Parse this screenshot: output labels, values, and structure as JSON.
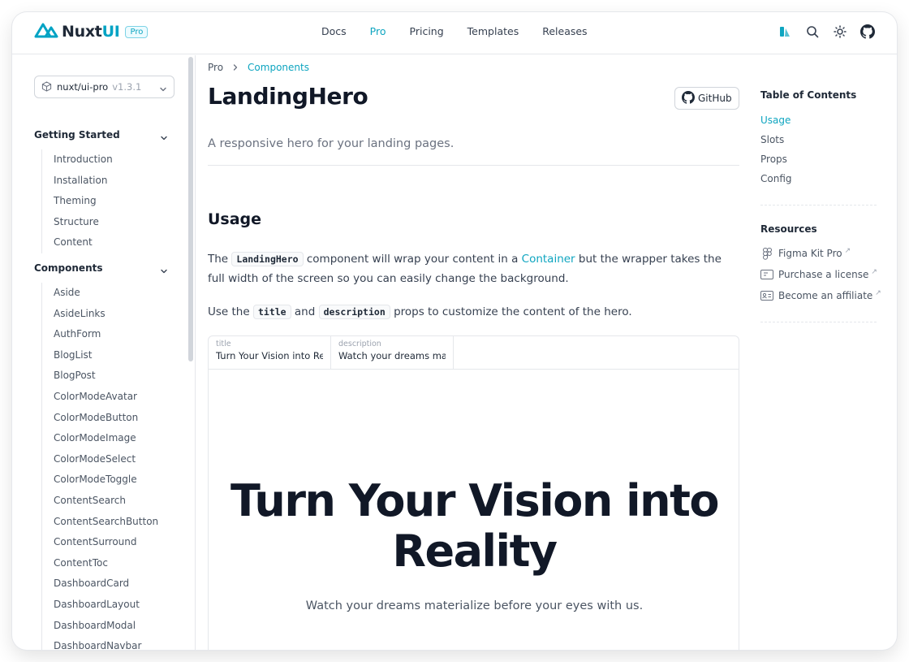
{
  "header": {
    "logo_text": "Nuxt",
    "logo_ui": "UI",
    "pro_badge": "Pro",
    "nav": [
      {
        "label": "Docs",
        "active": false
      },
      {
        "label": "Pro",
        "active": true
      },
      {
        "label": "Pricing",
        "active": false
      },
      {
        "label": "Templates",
        "active": false
      },
      {
        "label": "Releases",
        "active": false
      }
    ],
    "icons": [
      "nuxt-studio-icon",
      "search-icon",
      "sun-icon",
      "github-icon"
    ]
  },
  "sidebar": {
    "version_select": {
      "name": "nuxt/ui-pro",
      "version": "v1.3.1"
    },
    "groups": [
      {
        "title": "Getting Started",
        "items": [
          "Introduction",
          "Installation",
          "Theming",
          "Structure",
          "Content"
        ]
      },
      {
        "title": "Components",
        "items": [
          "Aside",
          "AsideLinks",
          "AuthForm",
          "BlogList",
          "BlogPost",
          "ColorModeAvatar",
          "ColorModeButton",
          "ColorModeImage",
          "ColorModeSelect",
          "ColorModeToggle",
          "ContentSearch",
          "ContentSearchButton",
          "ContentSurround",
          "ContentToc",
          "DashboardCard",
          "DashboardLayout",
          "DashboardModal",
          "DashboardNavbar"
        ]
      }
    ]
  },
  "main": {
    "breadcrumb": {
      "root": "Pro",
      "current": "Components"
    },
    "title": "LandingHero",
    "github_button": "GitHub",
    "description": "A responsive hero for your landing pages.",
    "usage_heading": "Usage",
    "para1": {
      "t1": "The",
      "code": "LandingHero",
      "t2": "component will wrap your content in a",
      "link": "Container",
      "t3": "but the wrapper takes the full width of the screen so you can easily change the background."
    },
    "para2": {
      "t1": "Use the",
      "code1": "title",
      "t2": "and",
      "code2": "description",
      "t3": "props to customize the content of the hero."
    },
    "preview": {
      "props": [
        {
          "label": "title",
          "value": "Turn Your Vision into Reality"
        },
        {
          "label": "description",
          "value": "Watch your dreams materialize before your eyes with us."
        }
      ],
      "hero_title": "Turn Your Vision into Reality",
      "hero_description": "Watch your dreams materialize before your eyes with us."
    }
  },
  "toc": {
    "title": "Table of Contents",
    "items": [
      {
        "label": "Usage",
        "active": true
      },
      {
        "label": "Slots",
        "active": false
      },
      {
        "label": "Props",
        "active": false
      },
      {
        "label": "Config",
        "active": false
      }
    ],
    "resources_title": "Resources",
    "resources": [
      "Figma Kit Pro",
      "Purchase a license",
      "Become an affiliate"
    ],
    "external_mark": "↗"
  },
  "colors": {
    "primary": "#0ea5c0",
    "text": "#111827",
    "muted": "#6b7280",
    "border": "#e5e7eb"
  }
}
